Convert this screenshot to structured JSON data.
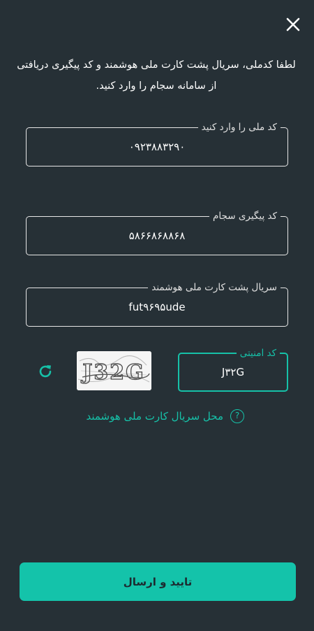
{
  "header": {
    "close_icon": "close-icon"
  },
  "intro_text": "لطفا کدملی، سریال پشت کارت ملی هوشمند و کد پیگیری دریافتی از سامانه سجام را وارد کنید.",
  "fields": {
    "national_code": {
      "label": "کد ملی را وارد کنید",
      "value": "۰۹۲۳۸۸۳۲۹۰"
    },
    "tracking_code": {
      "label": "کد پیگیری سجام",
      "value": "۵۸۶۶۸۶۸۸۶۸"
    },
    "card_serial": {
      "label": "سریال پشت کارت ملی هوشمند",
      "value": "fut۹۶۹۵ude"
    },
    "security_code": {
      "label": "کد امنیتی",
      "value": "J۳۲G"
    }
  },
  "captcha": {
    "text": "J32G",
    "refresh_icon": "refresh-icon"
  },
  "help": {
    "icon": "?",
    "text": "محل سریال کارت ملی هوشمند"
  },
  "submit_label": "تایید و ارسال",
  "colors": {
    "background": "#263036",
    "accent": "#14c3aa",
    "text": "#ffffff"
  }
}
